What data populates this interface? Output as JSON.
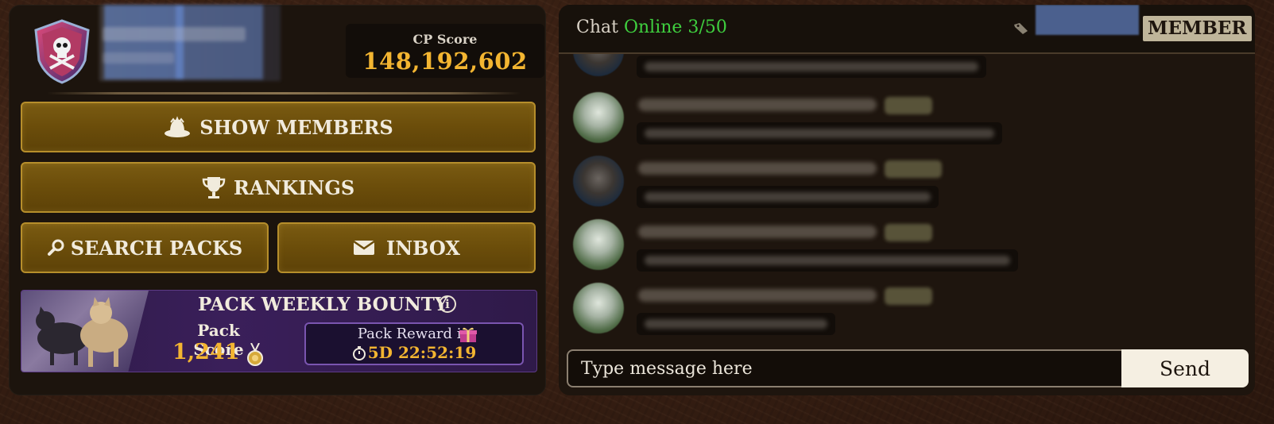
{
  "pack": {
    "cp_score_label": "CP Score",
    "cp_score_value": "148,192,602"
  },
  "actions": {
    "show_members": "SHOW MEMBERS",
    "rankings": "RANKINGS",
    "search_packs": "SEARCH PACKS",
    "inbox": "INBOX"
  },
  "bounty": {
    "title": "PACK WEEKLY BOUNTY",
    "info": "i",
    "score_label": "Pack Score",
    "score_value": "1,241",
    "reward_label": "Pack Reward in",
    "reward_time": "5D 22:52:19"
  },
  "chat": {
    "title": "Chat",
    "online": "Online 3/50",
    "role_badge": "MEMBER",
    "input_placeholder": "Type message here",
    "send_label": "Send"
  },
  "colors": {
    "gold_accent": "#f3b531",
    "online_green": "#3fcf3f",
    "button_gold": "#6b4d0a",
    "bounty_purple": "#3a1f5a"
  },
  "icons": [
    "skull-crest-icon",
    "members-icon",
    "trophy-icon",
    "search-icon",
    "mail-icon",
    "info-icon",
    "medal-icon",
    "gift-icon",
    "timer-icon",
    "tag-icon"
  ]
}
